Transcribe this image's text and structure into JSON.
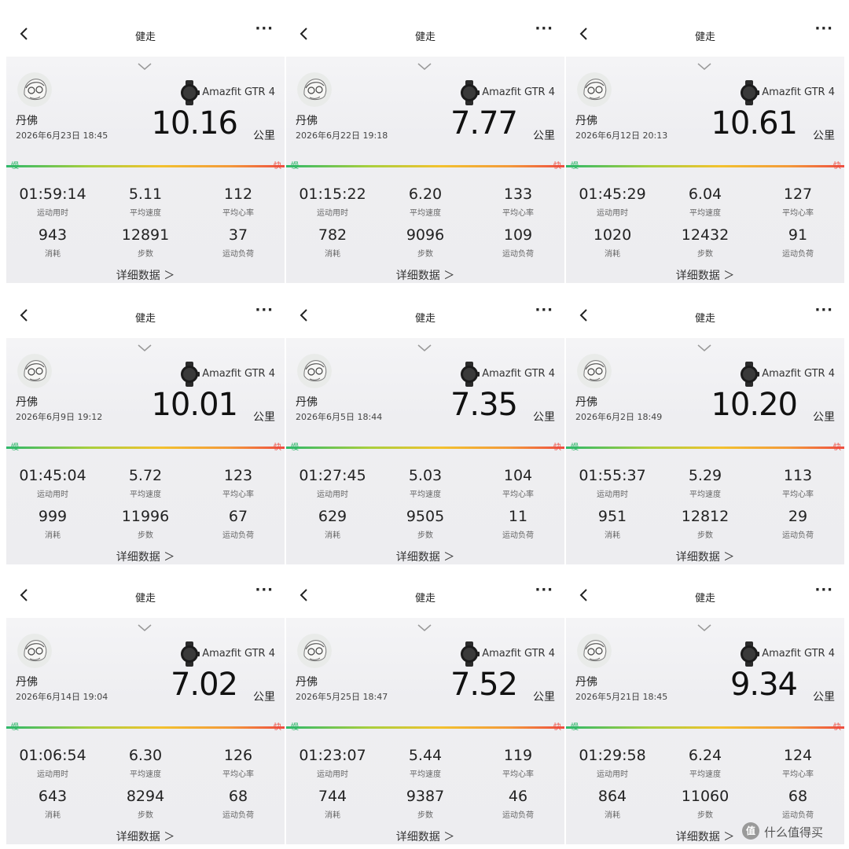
{
  "activity_title": "健走",
  "device_name": "Amazfit GTR 4",
  "user_name": "丹佛",
  "unit": "公里",
  "pace_slow": "慢",
  "pace_fast": "快",
  "details_label": "详细数据 ＞",
  "stat_labels": {
    "duration": "运动用时",
    "avg_speed": "平均速度",
    "avg_hr": "平均心率",
    "calories": "消耗",
    "steps": "步数",
    "load": "运动负荷"
  },
  "cards": [
    {
      "datetime": "2026年6月23日 18:45",
      "distance": "10.16",
      "duration": "01:59:14",
      "avg_speed": "5.11",
      "avg_hr": "112",
      "calories": "943",
      "steps": "12891",
      "load": "37"
    },
    {
      "datetime": "2026年6月22日 19:18",
      "distance": "7.77",
      "duration": "01:15:22",
      "avg_speed": "6.20",
      "avg_hr": "133",
      "calories": "782",
      "steps": "9096",
      "load": "109"
    },
    {
      "datetime": "2026年6月12日 20:13",
      "distance": "10.61",
      "duration": "01:45:29",
      "avg_speed": "6.04",
      "avg_hr": "127",
      "calories": "1020",
      "steps": "12432",
      "load": "91"
    },
    {
      "datetime": "2026年6月9日 19:12",
      "distance": "10.01",
      "duration": "01:45:04",
      "avg_speed": "5.72",
      "avg_hr": "123",
      "calories": "999",
      "steps": "11996",
      "load": "67"
    },
    {
      "datetime": "2026年6月5日 18:44",
      "distance": "7.35",
      "duration": "01:27:45",
      "avg_speed": "5.03",
      "avg_hr": "104",
      "calories": "629",
      "steps": "9505",
      "load": "11"
    },
    {
      "datetime": "2026年6月2日 18:49",
      "distance": "10.20",
      "duration": "01:55:37",
      "avg_speed": "5.29",
      "avg_hr": "113",
      "calories": "951",
      "steps": "12812",
      "load": "29"
    },
    {
      "datetime": "2026年6月14日 19:04",
      "distance": "7.02",
      "duration": "01:06:54",
      "avg_speed": "6.30",
      "avg_hr": "126",
      "calories": "643",
      "steps": "8294",
      "load": "68"
    },
    {
      "datetime": "2026年5月25日 18:47",
      "distance": "7.52",
      "duration": "01:23:07",
      "avg_speed": "5.44",
      "avg_hr": "119",
      "calories": "744",
      "steps": "9387",
      "load": "46"
    },
    {
      "datetime": "2026年5月21日 18:45",
      "distance": "9.34",
      "duration": "01:29:58",
      "avg_speed": "6.24",
      "avg_hr": "124",
      "calories": "864",
      "steps": "11060",
      "load": "68"
    }
  ],
  "watermark": {
    "logo": "值",
    "text": "什么值得买"
  },
  "colors": {
    "pace_green": "#2fb86a",
    "pace_red": "#ee4d40"
  }
}
